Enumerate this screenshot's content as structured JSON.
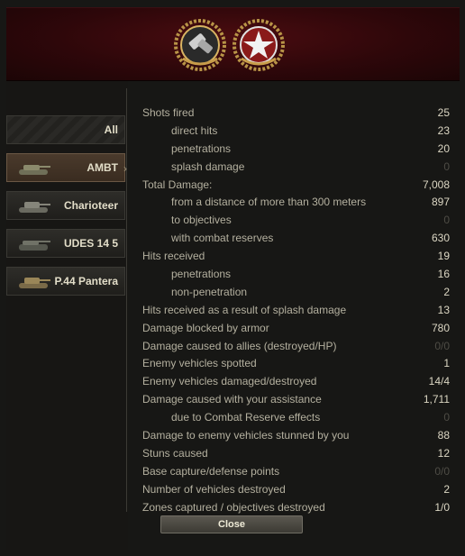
{
  "header": {
    "medals": [
      "artillery-medal-icon",
      "star-wreath-medal-icon"
    ]
  },
  "tabs": [
    {
      "label": "All",
      "icon": "",
      "active": false
    },
    {
      "label": "AMBT",
      "icon": "tank-icon",
      "active": true
    },
    {
      "label": "Charioteer",
      "icon": "tank-icon",
      "active": false
    },
    {
      "label": "UDES 14 5",
      "icon": "tank-icon",
      "active": false
    },
    {
      "label": "P.44 Pantera",
      "icon": "tank-icon",
      "active": false
    }
  ],
  "stats": [
    {
      "label": "Shots fired",
      "value": "25",
      "sub": false,
      "dim": false
    },
    {
      "label": "direct hits",
      "value": "23",
      "sub": true,
      "dim": false
    },
    {
      "label": "penetrations",
      "value": "20",
      "sub": true,
      "dim": false
    },
    {
      "label": "splash damage",
      "value": "0",
      "sub": true,
      "dim": true
    },
    {
      "label": "Total Damage:",
      "value": "7,008",
      "sub": false,
      "dim": false
    },
    {
      "label": "from a distance of more than 300 meters",
      "value": "897",
      "sub": true,
      "dim": false
    },
    {
      "label": "to objectives",
      "value": "0",
      "sub": true,
      "dim": true
    },
    {
      "label": "with combat reserves",
      "value": "630",
      "sub": true,
      "dim": false
    },
    {
      "label": "Hits received",
      "value": "19",
      "sub": false,
      "dim": false
    },
    {
      "label": "penetrations",
      "value": "16",
      "sub": true,
      "dim": false
    },
    {
      "label": "non-penetration",
      "value": "2",
      "sub": true,
      "dim": false
    },
    {
      "label": "Hits received as a result of splash damage",
      "value": "13",
      "sub": false,
      "dim": false
    },
    {
      "label": "Damage blocked by armor",
      "value": "780",
      "sub": false,
      "dim": false
    },
    {
      "label": "Damage caused to allies (destroyed/HP)",
      "value": "0/0",
      "sub": false,
      "dim": true
    },
    {
      "label": "Enemy vehicles spotted",
      "value": "1",
      "sub": false,
      "dim": false
    },
    {
      "label": "Enemy vehicles damaged/destroyed",
      "value": "14/4",
      "sub": false,
      "dim": false
    },
    {
      "label": "Damage caused with your assistance",
      "value": "1,711",
      "sub": false,
      "dim": false
    },
    {
      "label": "due to Combat Reserve effects",
      "value": "0",
      "sub": true,
      "dim": true
    },
    {
      "label": "Damage to enemy vehicles stunned by you",
      "value": "88",
      "sub": false,
      "dim": false
    },
    {
      "label": "Stuns caused",
      "value": "12",
      "sub": false,
      "dim": false
    },
    {
      "label": "Base capture/defense points",
      "value": "0/0",
      "sub": false,
      "dim": true
    },
    {
      "label": "Number of vehicles destroyed",
      "value": "2",
      "sub": false,
      "dim": false
    },
    {
      "label": "Zones captured / objectives destroyed",
      "value": "1/0",
      "sub": false,
      "dim": false
    }
  ],
  "footer": {
    "close_label": "Close"
  }
}
